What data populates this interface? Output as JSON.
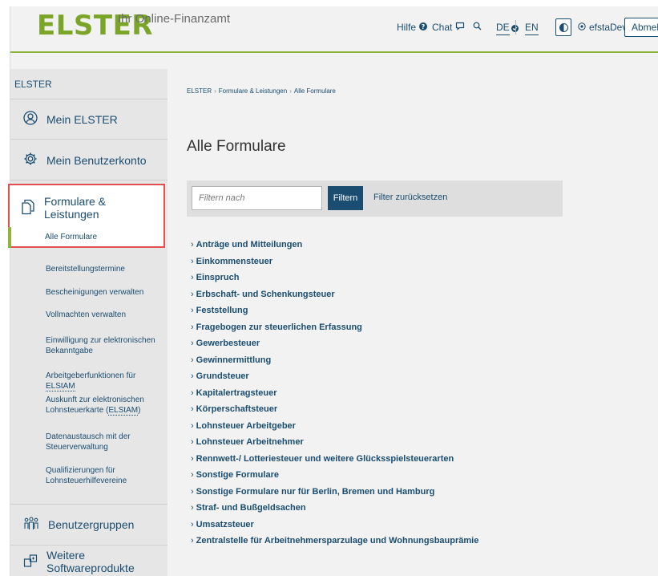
{
  "header": {
    "logo": "ELSTER",
    "tagline": "Ihr Online-Finanzamt",
    "help": "Hilfe",
    "chat": "Chat",
    "lang_de": "DE",
    "lang_en": "EN",
    "user": "efstaDev",
    "logout": "Abmelden"
  },
  "sidebar": {
    "top": "ELSTER",
    "main_items": [
      {
        "label": "Mein ELSTER",
        "icon": "user-circle-icon"
      },
      {
        "label": "Mein Benutzerkonto",
        "icon": "gear-icon"
      },
      {
        "label": "Formulare & Leistungen",
        "icon": "documents-icon"
      },
      {
        "label": "Benutzergruppen",
        "icon": "users-group-icon"
      },
      {
        "label": "Weitere Softwareprodukte",
        "icon": "software-icon"
      }
    ],
    "sub_items": [
      {
        "label": "Alle Formulare"
      },
      {
        "label": "Bereitstellungstermine"
      },
      {
        "label": "Bescheinigungen verwalten"
      },
      {
        "label": "Vollmachten verwalten"
      },
      {
        "label": "Einwilligung zur elektronischen Bekanntgabe"
      },
      {
        "label_pre": "Arbeitgeberfunktionen für ",
        "label_abbr": "ELStAM"
      },
      {
        "label_pre": "Auskunft zur elektronischen Lohnsteuerkarte (",
        "label_abbr": "ELStAM",
        "label_post": ")"
      },
      {
        "label": "Datenaustausch mit der Steuerverwaltung"
      },
      {
        "label": "Qualifizierungen für Lohnsteuerhilfevereine"
      }
    ]
  },
  "breadcrumb": [
    "ELSTER",
    "Formulare & Leistungen",
    "Alle Formulare"
  ],
  "main": {
    "title": "Alle Formulare",
    "filter_placeholder": "Filtern nach",
    "filter_button": "Filtern",
    "filter_reset": "Filter zurücksetzen"
  },
  "forms": [
    "Anträge und Mitteilungen",
    "Einkommensteuer",
    "Einspruch",
    "Erbschaft- und Schenkungsteuer",
    "Feststellung",
    "Fragebogen zur steuerlichen Erfassung",
    "Gewerbesteuer",
    "Gewinnermittlung",
    "Grundsteuer",
    "Kapitalertragsteuer",
    "Körperschaftsteuer",
    "Lohnsteuer Arbeitgeber",
    "Lohnsteuer Arbeitnehmer",
    "Rennwett-/ Lotteriesteuer und weitere Glücksspielsteuerarten",
    "Sonstige Formulare",
    "Sonstige Formulare nur für Berlin, Bremen und Hamburg",
    "Straf- und Bußgeldsachen",
    "Umsatzsteuer",
    "Zentralstelle für Arbeitnehmersparzulage und Wohnungsbauprämie"
  ],
  "colors": {
    "brand_green": "#7ba528",
    "link_blue": "#1a4d70",
    "highlight_red": "#e05050"
  }
}
